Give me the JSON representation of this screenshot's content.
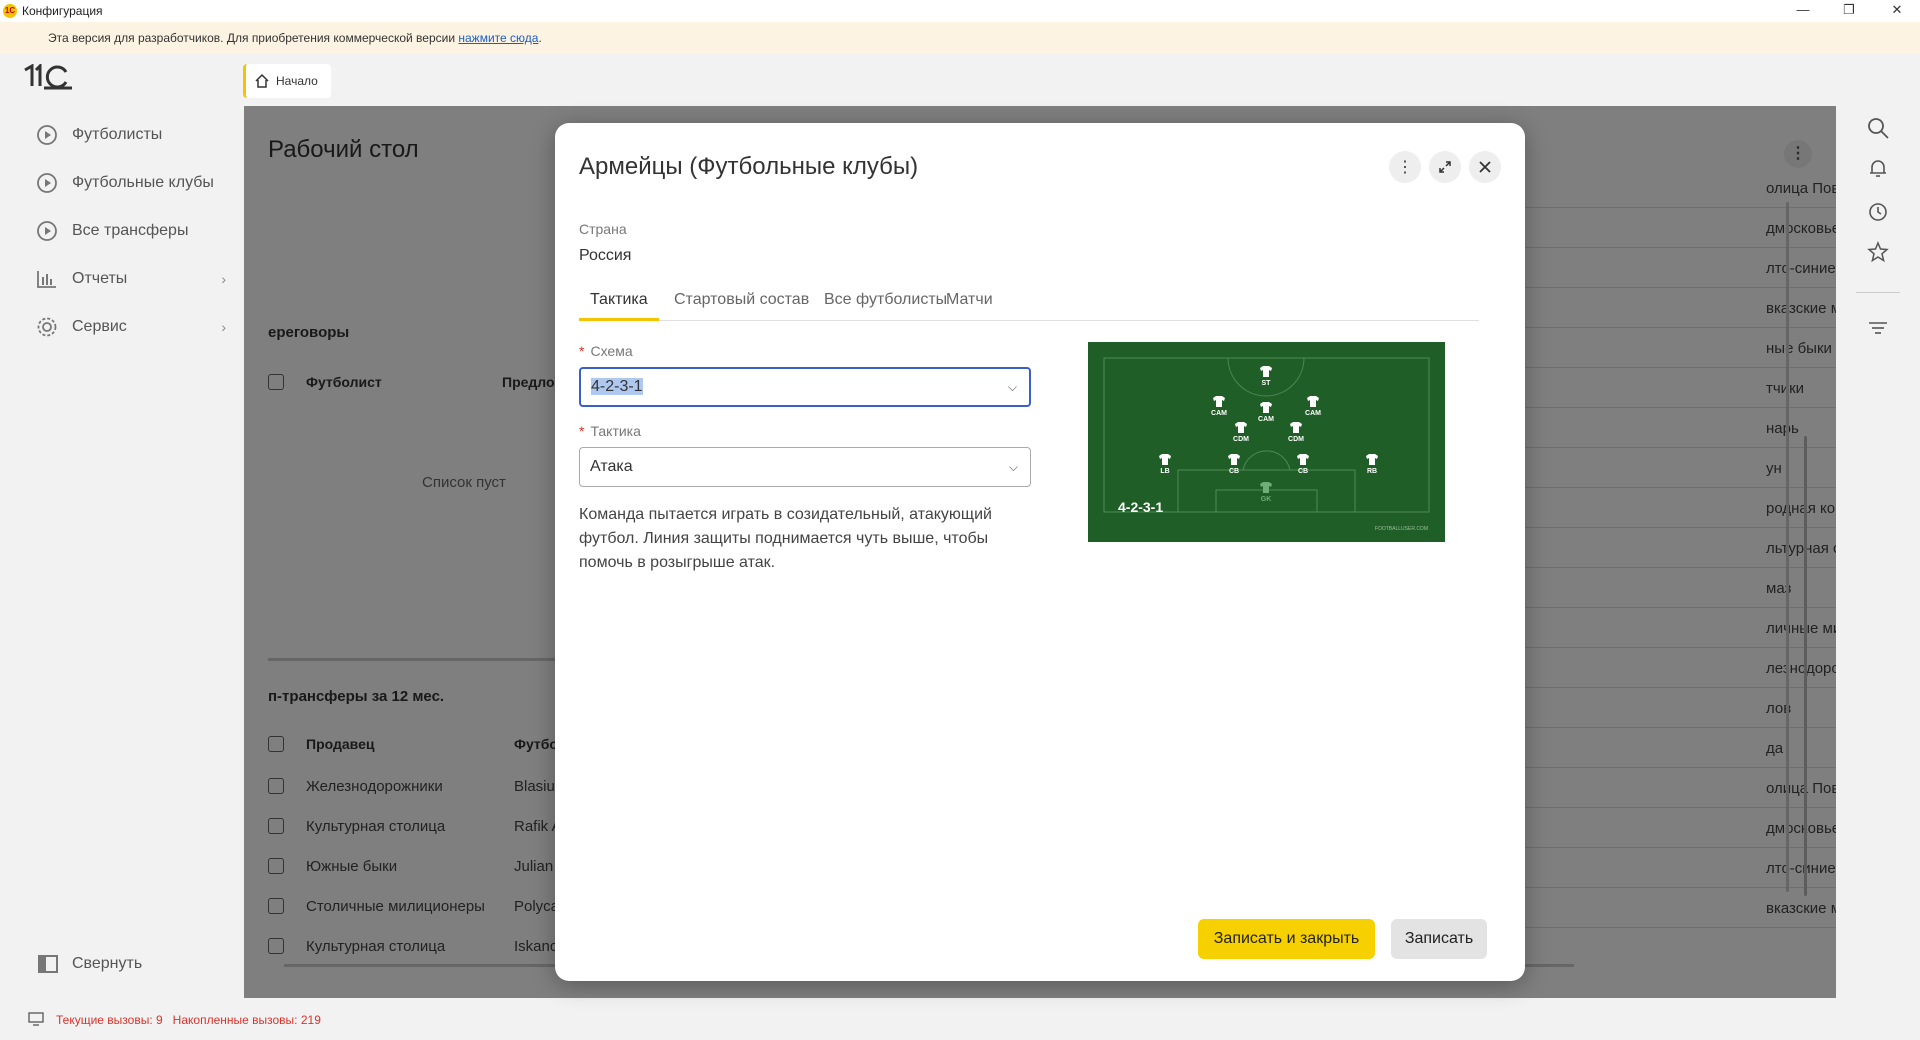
{
  "window": {
    "title": "Конфигурация"
  },
  "banner": {
    "text": "Эта версия для разработчиков. Для приобретения коммерческой версии ",
    "link": "нажмите сюда",
    "end": "."
  },
  "sidebar": {
    "items": [
      {
        "label": "Футболисты",
        "icon": "play-circle-icon"
      },
      {
        "label": "Футбольные клубы",
        "icon": "play-circle-icon"
      },
      {
        "label": "Все трансферы",
        "icon": "play-circle-icon"
      },
      {
        "label": "Отчеты",
        "icon": "bar-chart-icon"
      },
      {
        "label": "Сервис",
        "icon": "gear-icon"
      }
    ],
    "collapse_label": "Свернуть"
  },
  "tabs": {
    "home_label": "Начало"
  },
  "workspace": {
    "title": "Рабочий стол",
    "negotiations": {
      "title": "ереговоры",
      "col_player": "Футболист",
      "col_offer": "Предло",
      "empty": "Список пуст"
    },
    "transfers": {
      "title": "п-трансферы за 12 мес.",
      "col_seller": "Продавец",
      "col_player": "Футбо",
      "rows": [
        {
          "seller": "Железнодорожники",
          "player": "Blasiu"
        },
        {
          "seller": "Культурная столица",
          "player": "Rafik A"
        },
        {
          "seller": "Южные быки",
          "player": "Julian"
        },
        {
          "seller": "Столичные милиционеры",
          "player": "Polyca"
        },
        {
          "seller": "Культурная столица",
          "player": "Iskanc"
        }
      ]
    },
    "right_list": [
      "олица Поволжья",
      "дмосковье",
      "лто-синие южане",
      "вказские милиционеры",
      "ные быки",
      "тчики",
      "нарь",
      "ун",
      "родная команда",
      "льтурная столица",
      "маз",
      "личные милиционеры",
      "лезнодорожники",
      "лов",
      "да",
      "олица Поволжья",
      "дмосковье",
      "лто-синие южане",
      "вказские милиционеры"
    ],
    "right_list_dash": "-"
  },
  "statusbar": {
    "text": "Текущие вызовы: 9   Накопленные вызовы: 219"
  },
  "dialog": {
    "title": "Армейцы (Футбольные клубы)",
    "country_label": "Страна",
    "country_value": "Россия",
    "tabs": [
      "Тактика",
      "Стартовый состав",
      "Все футболисты",
      "Матчи"
    ],
    "scheme_label": "Схема",
    "scheme_value": "4-2-3-1",
    "tactic_label": "Тактика",
    "tactic_value": "Атака",
    "description": "Команда пытается играть в созидательный, атакующий футбол. Линия защиты поднимается чуть выше, чтобы помочь в розыгрыше атак.",
    "formation": {
      "label": "4-2-3-1",
      "credit": "FOOTBALLUSER.COM",
      "positions": [
        "ST",
        "CAM",
        "CAM",
        "CAM",
        "CDM",
        "CDM",
        "LB",
        "CB",
        "CB",
        "RB",
        "GK"
      ]
    },
    "save_close_label": "Записать и закрыть",
    "save_label": "Записать"
  },
  "colors": {
    "accent": "#f7d000",
    "focus": "#3a5fcd",
    "pitch": "#1f5e26",
    "status_red": "#d9342b"
  }
}
